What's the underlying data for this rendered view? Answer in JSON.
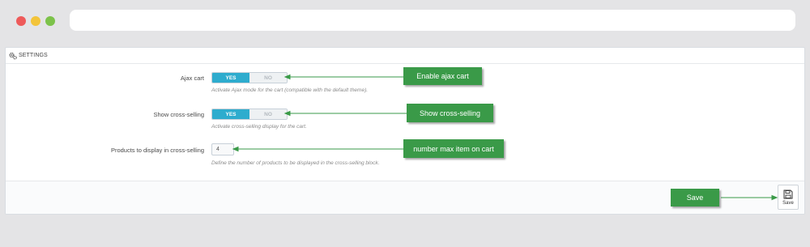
{
  "panel": {
    "title": "SETTINGS"
  },
  "fields": [
    {
      "label": "Ajax cart",
      "yes": "YES",
      "no": "NO",
      "help": "Activate Ajax mode for the cart (compatible with the default theme)."
    },
    {
      "label": "Show cross-selling",
      "yes": "YES",
      "no": "NO",
      "help": "Activate cross-selling display for the cart."
    },
    {
      "label": "Products to display in cross-selling",
      "value": "4",
      "help": "Define the number of products to be displayed in the cross-selling block."
    }
  ],
  "footer": {
    "save_label": "Save"
  },
  "callouts": {
    "ajax": "Enable ajax cart",
    "cross": "Show cross-selling",
    "number": "number max item on cart",
    "save": "Save"
  },
  "colors": {
    "switch_on": "#2eacce",
    "callout": "#3a9a48"
  }
}
